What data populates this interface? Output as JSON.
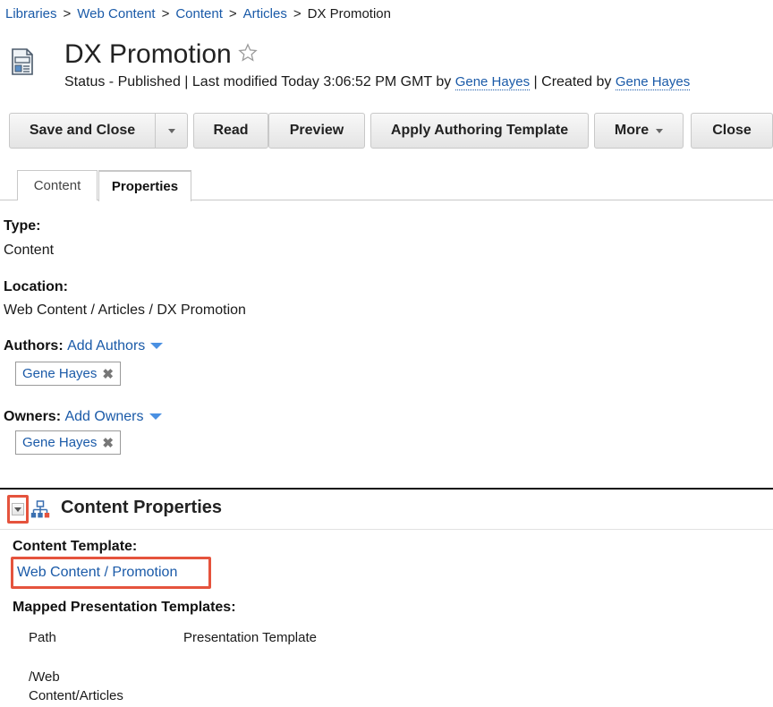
{
  "breadcrumb": {
    "items": [
      "Libraries",
      "Web Content",
      "Content",
      "Articles"
    ],
    "current": "DX Promotion",
    "separator": ">"
  },
  "header": {
    "title": "DX Promotion",
    "status_prefix": "Status - Published | Last modified Today 3:06:52 PM GMT by",
    "modified_by": "Gene Hayes",
    "created_prefix": "| Created by",
    "created_by": "Gene Hayes"
  },
  "toolbar": {
    "save_close": "Save and Close",
    "read": "Read",
    "preview": "Preview",
    "apply_template": "Apply Authoring Template",
    "more": "More",
    "close": "Close"
  },
  "tabs": [
    {
      "label": "Content",
      "active": false
    },
    {
      "label": "Properties",
      "active": true
    }
  ],
  "properties": {
    "type_label": "Type:",
    "type_value": "Content",
    "location_label": "Location:",
    "location_value": "Web Content / Articles / DX Promotion",
    "authors_label": "Authors:",
    "authors_add": "Add Authors",
    "authors": [
      "Gene Hayes"
    ],
    "owners_label": "Owners:",
    "owners_add": "Add Owners",
    "owners": [
      "Gene Hayes"
    ],
    "remove_glyph": "✖"
  },
  "content_properties": {
    "title": "Content Properties",
    "template_label": "Content Template:",
    "template_value": "Web Content / Promotion",
    "mapped_label": "Mapped Presentation Templates:",
    "columns": [
      "Path",
      "Presentation Template"
    ],
    "rows": [
      {
        "path": "/Web Content/Articles",
        "template": ""
      }
    ]
  },
  "colors": {
    "link": "#1a5aa8",
    "highlight": "#e5533d",
    "caret": "#4a90e2"
  }
}
